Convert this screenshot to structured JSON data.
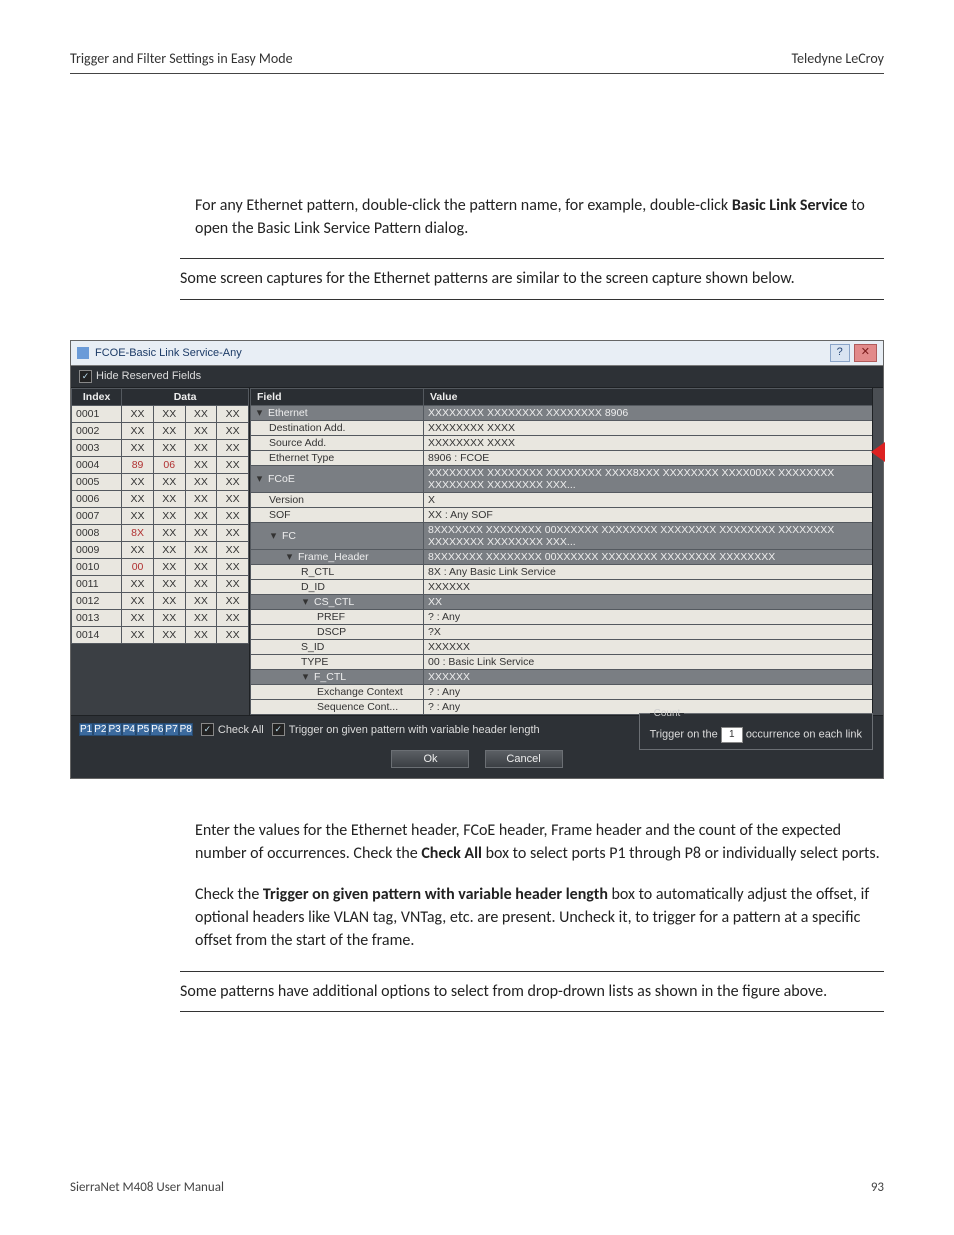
{
  "header": {
    "left": "Trigger and Filter Settings in Easy Mode",
    "right": "Teledyne  LeCroy"
  },
  "para1": {
    "pre": "For any Ethernet pattern, double-click the pattern name, for example, double-click ",
    "bold": "Basic Link Service",
    "post": " to open the Basic Link Service Pattern dialog."
  },
  "note1": "Some screen captures for the Ethernet patterns are similar to the screen capture shown below.",
  "dialog": {
    "title": "FCOE-Basic Link Service-Any",
    "help_icon": "?",
    "close_icon": "✕",
    "hide_reserved_label": "Hide Reserved Fields",
    "data_headers": {
      "index": "Index",
      "data": "Data"
    },
    "data_rows": [
      {
        "idx": "0001",
        "c": [
          "XX",
          "XX",
          "XX",
          "XX"
        ],
        "red": []
      },
      {
        "idx": "0002",
        "c": [
          "XX",
          "XX",
          "XX",
          "XX"
        ],
        "red": []
      },
      {
        "idx": "0003",
        "c": [
          "XX",
          "XX",
          "XX",
          "XX"
        ],
        "red": []
      },
      {
        "idx": "0004",
        "c": [
          "89",
          "06",
          "XX",
          "XX"
        ],
        "red": [
          0,
          1
        ]
      },
      {
        "idx": "0005",
        "c": [
          "XX",
          "XX",
          "XX",
          "XX"
        ],
        "red": []
      },
      {
        "idx": "0006",
        "c": [
          "XX",
          "XX",
          "XX",
          "XX"
        ],
        "red": []
      },
      {
        "idx": "0007",
        "c": [
          "XX",
          "XX",
          "XX",
          "XX"
        ],
        "red": []
      },
      {
        "idx": "0008",
        "c": [
          "8X",
          "XX",
          "XX",
          "XX"
        ],
        "red": [
          0
        ]
      },
      {
        "idx": "0009",
        "c": [
          "XX",
          "XX",
          "XX",
          "XX"
        ],
        "red": []
      },
      {
        "idx": "0010",
        "c": [
          "00",
          "XX",
          "XX",
          "XX"
        ],
        "red": [
          0
        ]
      },
      {
        "idx": "0011",
        "c": [
          "XX",
          "XX",
          "XX",
          "XX"
        ],
        "red": []
      },
      {
        "idx": "0012",
        "c": [
          "XX",
          "XX",
          "XX",
          "XX"
        ],
        "red": []
      },
      {
        "idx": "0013",
        "c": [
          "XX",
          "XX",
          "XX",
          "XX"
        ],
        "red": []
      },
      {
        "idx": "0014",
        "c": [
          "XX",
          "XX",
          "XX",
          "XX"
        ],
        "red": []
      }
    ],
    "tree_headers": {
      "field": "Field",
      "value": "Value"
    },
    "tree": [
      {
        "type": "group",
        "indent": 0,
        "label": "Ethernet",
        "value": "XXXXXXXX XXXXXXXX XXXXXXXX 8906"
      },
      {
        "type": "leaf",
        "indent": 1,
        "label": "Destination Add.",
        "value": "XXXXXXXX XXXX"
      },
      {
        "type": "leaf",
        "indent": 1,
        "label": "Source Add.",
        "value": "XXXXXXXX XXXX"
      },
      {
        "type": "leaf",
        "indent": 1,
        "label": "Ethernet Type",
        "value": "8906 : FCOE"
      },
      {
        "type": "group",
        "indent": 0,
        "label": "FCoE",
        "value": "XXXXXXXX XXXXXXXX XXXXXXXX XXXX8XXX XXXXXXXX XXXX00XX XXXXXXXX XXXXXXXX XXXXXXXX XXX..."
      },
      {
        "type": "leaf",
        "indent": 1,
        "label": "Version",
        "value": "X"
      },
      {
        "type": "leaf",
        "indent": 1,
        "label": "SOF",
        "value": "XX : Any SOF"
      },
      {
        "type": "group",
        "indent": 1,
        "label": "FC",
        "value": "8XXXXXXX XXXXXXXX 00XXXXXX XXXXXXXX XXXXXXXX XXXXXXXX XXXXXXXX XXXXXXXX XXXXXXXX XXX..."
      },
      {
        "type": "group",
        "indent": 2,
        "label": "Frame_Header",
        "value": "8XXXXXXX XXXXXXXX 00XXXXXX XXXXXXXX XXXXXXXX XXXXXXXX"
      },
      {
        "type": "leaf",
        "indent": 3,
        "label": "R_CTL",
        "value": "8X : Any Basic Link Service"
      },
      {
        "type": "leaf",
        "indent": 3,
        "label": "D_ID",
        "value": "XXXXXX"
      },
      {
        "type": "group",
        "indent": 3,
        "label": "CS_CTL",
        "value": "XX"
      },
      {
        "type": "leaf",
        "indent": 4,
        "label": "PREF",
        "value": "? : Any"
      },
      {
        "type": "leaf",
        "indent": 4,
        "label": "DSCP",
        "value": "?X"
      },
      {
        "type": "leaf",
        "indent": 3,
        "label": "S_ID",
        "value": "XXXXXX"
      },
      {
        "type": "leaf",
        "indent": 3,
        "label": "TYPE",
        "value": "00 : Basic Link Service"
      },
      {
        "type": "group",
        "indent": 3,
        "label": "F_CTL",
        "value": "XXXXXX"
      },
      {
        "type": "leaf",
        "indent": 4,
        "label": "Exchange Context",
        "value": "? : Any"
      },
      {
        "type": "leaf",
        "indent": 4,
        "label": "Sequence Cont...",
        "value": "? : Any"
      }
    ],
    "ports": [
      "P1",
      "P2",
      "P3",
      "P4",
      "P5",
      "P6",
      "P7",
      "P8"
    ],
    "check_all_label": "Check All",
    "variable_header_label": "Trigger on given pattern with variable header length",
    "count_legend": "Count",
    "count_pre": "Trigger on the",
    "count_value": "1",
    "count_post": "occurrence on each link",
    "ok_label": "Ok",
    "cancel_label": "Cancel"
  },
  "para2": {
    "pre": "Enter the values for the Ethernet header, FCoE header, Frame header and the count of the expected number of occurrences. Check the ",
    "bold": "Check All",
    "post": " box to select ports P1 through P8 or individually select ports."
  },
  "para3": {
    "pre": "Check the ",
    "bold": "Trigger on given pattern with variable header length",
    "post": " box to automatically adjust the offset, if optional headers like VLAN tag, VNTag, etc. are present. Uncheck it, to trigger for a pattern at a specific offset from the start of the frame."
  },
  "note2": "Some patterns have additional options to select from drop-drown lists as shown in the figure above.",
  "footer": {
    "left": "SierraNet M408 User Manual",
    "right": "93"
  }
}
